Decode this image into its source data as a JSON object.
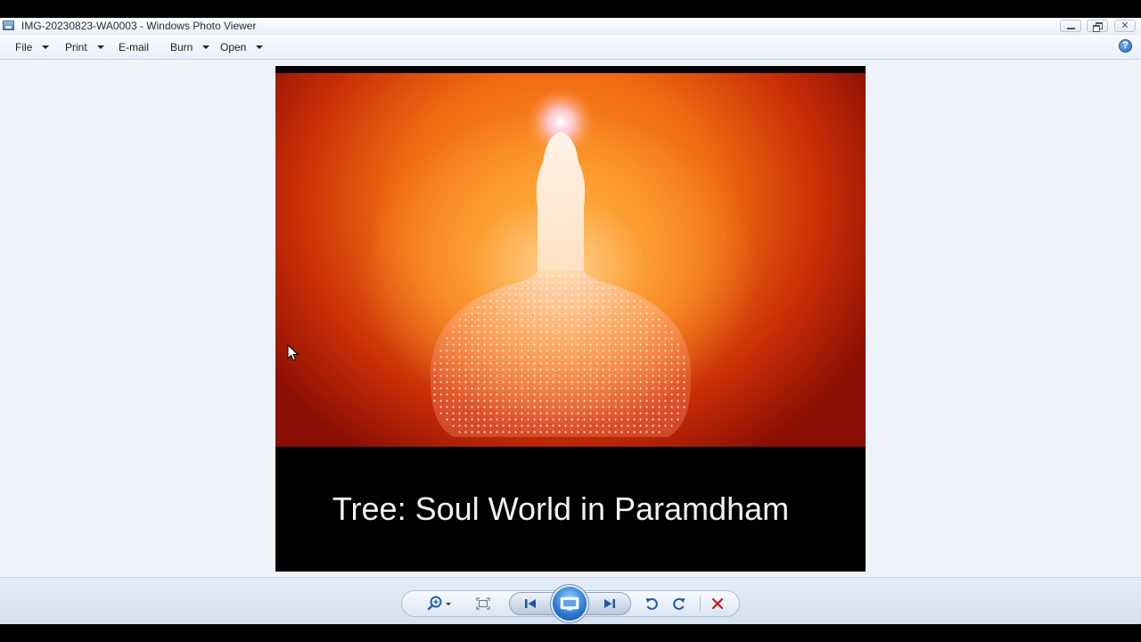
{
  "window": {
    "title": "IMG-20230823-WA0003 - Windows Photo Viewer",
    "app_icon": "photo-viewer-icon",
    "controls": [
      "minimize-icon",
      "restore-icon",
      "close-icon"
    ]
  },
  "menu": {
    "items": [
      {
        "label": "File",
        "has_dropdown": true
      },
      {
        "label": "Print",
        "has_dropdown": true
      },
      {
        "label": "E-mail",
        "has_dropdown": false
      },
      {
        "label": "Burn",
        "has_dropdown": true
      },
      {
        "label": "Open",
        "has_dropdown": true
      }
    ],
    "help_glyph": "?"
  },
  "photo": {
    "caption": "Tree: Soul World in Paramdham"
  },
  "toolbar": {
    "buttons": [
      "zoom-icon",
      "actual-size-icon",
      "previous-icon",
      "slideshow-icon",
      "next-icon",
      "rotate-counterclockwise-icon",
      "rotate-clockwise-icon",
      "delete-icon"
    ]
  },
  "colors": {
    "window_bg": "#eef3fa",
    "accent_blue": "#2a76d0",
    "delete_red": "#c8161d",
    "photo_orange": "#f06a12",
    "photo_deep_red": "#8a0e04"
  }
}
